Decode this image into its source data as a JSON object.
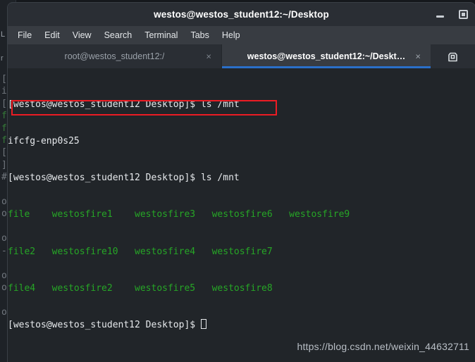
{
  "window": {
    "title": "westos@westos_student12:~/Desktop",
    "minimize_label": "minimize",
    "maximize_label": "maximize"
  },
  "menubar": {
    "items": [
      {
        "label": "File"
      },
      {
        "label": "Edit"
      },
      {
        "label": "View"
      },
      {
        "label": "Search"
      },
      {
        "label": "Terminal"
      },
      {
        "label": "Tabs"
      },
      {
        "label": "Help"
      }
    ]
  },
  "tabs": [
    {
      "label": "root@westos_student12:/",
      "close": "×",
      "active": false
    },
    {
      "label": "westos@westos_student12:~/Deskt…",
      "close": "×",
      "active": true
    }
  ],
  "newtab": {
    "label": "new-tab"
  },
  "terminal": {
    "prompt": "[westos@westos_student12 Desktop]$ ",
    "lines": [
      {
        "type": "prompt",
        "prompt": "[westos@westos_student12 Desktop]$ ",
        "command": "ls /mnt"
      },
      {
        "type": "output",
        "text": "ifcfg-enp0s25"
      },
      {
        "type": "prompt",
        "prompt": "[westos@westos_student12 Desktop]$ ",
        "command": "ls /mnt",
        "highlighted": true
      },
      {
        "type": "listing",
        "text": "file    westosfire1    westosfire3   westosfire6   westosfire9"
      },
      {
        "type": "listing",
        "text": "file2   westosfire10   westosfire4   westosfire7"
      },
      {
        "type": "listing",
        "text": "file4   westosfire2    westosfire5   westosfire8"
      },
      {
        "type": "prompt-cursor",
        "prompt": "[westos@westos_student12 Desktop]$ "
      }
    ]
  },
  "background_window": {
    "menu_ghost": "L",
    "tab_ghost": "r",
    "strip": "[\nif\n[\nf\nf\nf\n[\n]\n#\n\n\no\no\n\no\n-\n\no\no\n\no\n\n."
  },
  "watermark": {
    "text": "https://blog.csdn.net/weixin_44632711"
  },
  "colors": {
    "titlebar_bg": "#2a2e34",
    "menubar_bg": "#383c42",
    "terminal_bg": "#212529",
    "tab_active_accent": "#2a6fc9",
    "output_green": "#26a626",
    "annotation_red": "#ec1c24",
    "text_white": "#e6e9ec"
  }
}
